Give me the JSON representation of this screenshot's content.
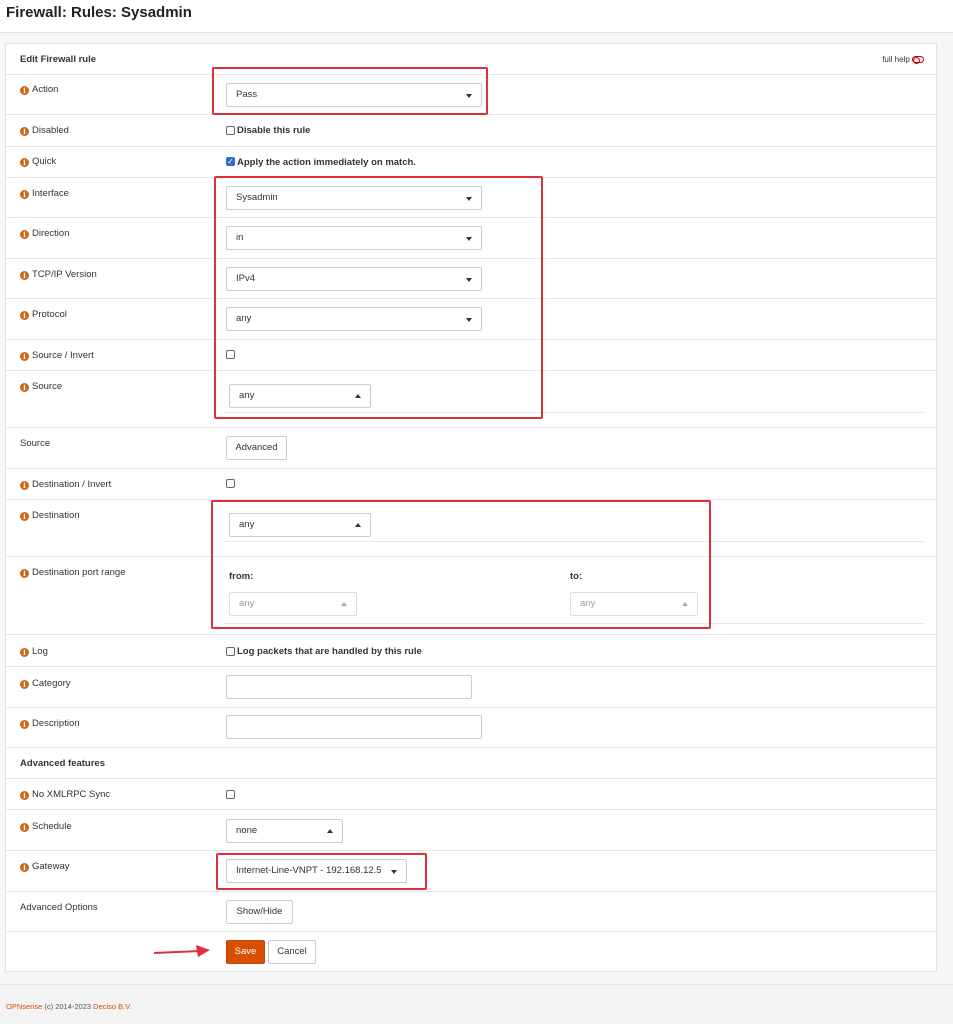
{
  "page": {
    "title": "Firewall: Rules: Sysadmin"
  },
  "panel": {
    "header": "Edit Firewall rule",
    "full_help": "full help"
  },
  "rows": {
    "action": {
      "label": "Action",
      "value": "Pass"
    },
    "disabled": {
      "label": "Disabled",
      "checkbox_label": "Disable this rule",
      "checked": false
    },
    "quick": {
      "label": "Quick",
      "checkbox_label": "Apply the action immediately on match.",
      "checked": true
    },
    "interface": {
      "label": "Interface",
      "value": "Sysadmin"
    },
    "direction": {
      "label": "Direction",
      "value": "in"
    },
    "tcpip": {
      "label": "TCP/IP Version",
      "value": "IPv4"
    },
    "protocol": {
      "label": "Protocol",
      "value": "any"
    },
    "source_invert": {
      "label": "Source / Invert",
      "checked": false
    },
    "source": {
      "label": "Source",
      "value": "any"
    },
    "source_adv": {
      "label": "Source",
      "button": "Advanced"
    },
    "dest_invert": {
      "label": "Destination / Invert",
      "checked": false
    },
    "destination": {
      "label": "Destination",
      "value": "any"
    },
    "dest_port": {
      "label": "Destination port range",
      "from_label": "from:",
      "to_label": "to:",
      "from_value": "any",
      "to_value": "any"
    },
    "log": {
      "label": "Log",
      "checkbox_label": "Log packets that are handled by this rule",
      "checked": false
    },
    "category": {
      "label": "Category",
      "value": ""
    },
    "description": {
      "label": "Description",
      "value": ""
    },
    "advanced_features": {
      "label": "Advanced features"
    },
    "no_xmlrpc": {
      "label": "No XMLRPC Sync",
      "checked": false
    },
    "schedule": {
      "label": "Schedule",
      "value": "none"
    },
    "gateway": {
      "label": "Gateway",
      "value": "Internet-Line-VNPT - 192.168.12.5"
    },
    "advanced_options": {
      "label": "Advanced Options",
      "button": "Show/Hide"
    }
  },
  "actions": {
    "save": "Save",
    "cancel": "Cancel"
  },
  "footer": {
    "brand": "OPNsense",
    "copyright": "(c) 2014-2023",
    "company": "Deciso B.V."
  },
  "colors": {
    "accent": "#d94f00",
    "highlight": "#e0303a",
    "checkbox_checked": "#2d6fd0"
  }
}
